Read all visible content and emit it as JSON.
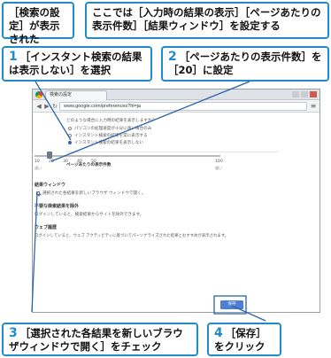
{
  "headers": {
    "left": "［検索の設定］が表示された",
    "right": "ここでは［入力時の結果の表示］［ページあたりの表示件数］［結果ウィンドウ］を設定する"
  },
  "callouts": [
    {
      "num": "1",
      "text": "［インスタント検索の結果は表示しない］を選択"
    },
    {
      "num": "2",
      "text": "［ページあたりの表示件数］を［20］に設定"
    },
    {
      "num": "3",
      "text": "［選択された各結果を新しいブラウザウィンドウで開く］をチェック"
    },
    {
      "num": "4",
      "text": "［保存］をクリック"
    }
  ],
  "browser": {
    "tab_title": "検索の設定",
    "url": "www.google.com/preferences?hl=ja",
    "content": {
      "instant_heading": "どのような場合に入力時の結果を表示しますか？",
      "instant_options": [
        "パソコンの処理速度が十分に速い場合のみ",
        "インスタント検索の結果を常に表示する",
        "インスタント検索の結果を表示しない"
      ],
      "per_page_heading": "ページあたりの表示件数",
      "per_page_ticks": [
        "10",
        "20",
        "30",
        "40",
        "50",
        "100"
      ],
      "per_page_tick_notes": [
        "速い",
        "遅い"
      ],
      "window_heading": "結果ウィンドウ",
      "window_option": "選択された各結果を新しいブラウザ ウィンドウで開く。",
      "block_heading": "不要な検索結果を除外",
      "block_text": "ログインしていると、検索結果からサイトを除外できます。",
      "web_history_heading": "ウェブ履歴",
      "web_history_text": "ログインしていると、ウェブ アクティビティに基づいてパーソナライズされた結果とおすすめが表示されます。",
      "save_label": "保存"
    }
  },
  "colors": {
    "accent": "#1f8cc9",
    "leader": "#2a63a8",
    "save_button": "#4d7fd6"
  }
}
